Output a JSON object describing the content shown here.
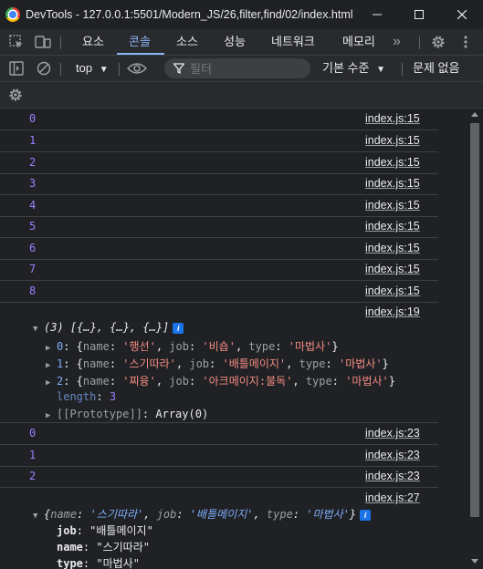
{
  "window": {
    "title": "DevTools - 127.0.0.1:5501/Modern_JS/26,filter,find/02/index.html"
  },
  "tabs": [
    {
      "label": "요소",
      "active": false
    },
    {
      "label": "콘솔",
      "active": true
    },
    {
      "label": "소스",
      "active": false
    },
    {
      "label": "성능",
      "active": false
    },
    {
      "label": "네트워크",
      "active": false
    },
    {
      "label": "메모리",
      "active": false
    }
  ],
  "toolbar": {
    "more_tabs": "»",
    "context": "top",
    "filter_placeholder": "필터",
    "level": "기본 수준",
    "issues": "문제 없음"
  },
  "colors": {
    "accent": "#8ab4f8",
    "number": "#9980ff",
    "string": "#f28b82",
    "key": "#7cacf8",
    "background": "#202124"
  },
  "log": {
    "numbers": [
      {
        "value": "0",
        "source": "index.js:15"
      },
      {
        "value": "1",
        "source": "index.js:15"
      },
      {
        "value": "2",
        "source": "index.js:15"
      },
      {
        "value": "3",
        "source": "index.js:15"
      },
      {
        "value": "4",
        "source": "index.js:15"
      },
      {
        "value": "5",
        "source": "index.js:15"
      },
      {
        "value": "6",
        "source": "index.js:15"
      },
      {
        "value": "7",
        "source": "index.js:15"
      },
      {
        "value": "8",
        "source": "index.js:15"
      }
    ],
    "array_source": "index.js:19",
    "array_summary": "(3) [{…}, {…}, {…}]",
    "array_items": [
      {
        "index": "0",
        "name": "'행선'",
        "job": "'비숍'",
        "type": "'마법사'"
      },
      {
        "index": "1",
        "name": "'스기따라'",
        "job": "'배틀메이지'",
        "type": "'마법사'"
      },
      {
        "index": "2",
        "name": "'찌융'",
        "job": "'아크메이지:불독'",
        "type": "'마법사'"
      }
    ],
    "length_key": "length",
    "length_value": "3",
    "prototype_key": "[[Prototype]]",
    "prototype_value": "Array(0)",
    "numbers2": [
      {
        "value": "0",
        "source": "index.js:23"
      },
      {
        "value": "1",
        "source": "index.js:23"
      },
      {
        "value": "2",
        "source": "index.js:23"
      }
    ],
    "object_source": "index.js:27",
    "object_summary": {
      "name": "'스기따라'",
      "job": "'배틀메이지'",
      "type": "'마법사'"
    },
    "object_props": [
      {
        "key": "job",
        "value": "\"배틀메이지\""
      },
      {
        "key": "name",
        "value": "\"스기따라\""
      },
      {
        "key": "type",
        "value": "\"마법사\""
      }
    ]
  }
}
